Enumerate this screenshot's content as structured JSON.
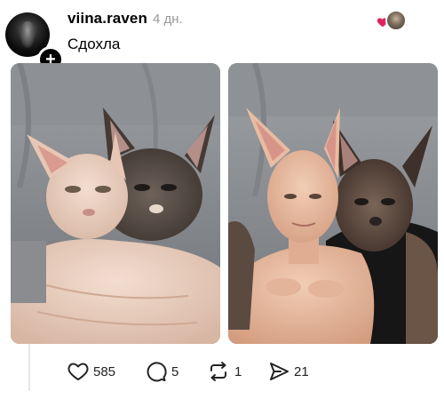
{
  "post": {
    "username": "viina.raven",
    "time": "4 дн.",
    "text": "Сдохла",
    "follow_icon": "plus",
    "liker_heart_color": "#e0245e"
  },
  "actions": {
    "like_count": "585",
    "reply_count": "5",
    "repost_count": "1",
    "share_count": "21"
  },
  "media": [
    {
      "kind": "photo",
      "subject": "two sphynx cats on a grey sofa"
    },
    {
      "kind": "photo",
      "subject": "two men made up as sphynx cats on a grey sofa"
    }
  ]
}
